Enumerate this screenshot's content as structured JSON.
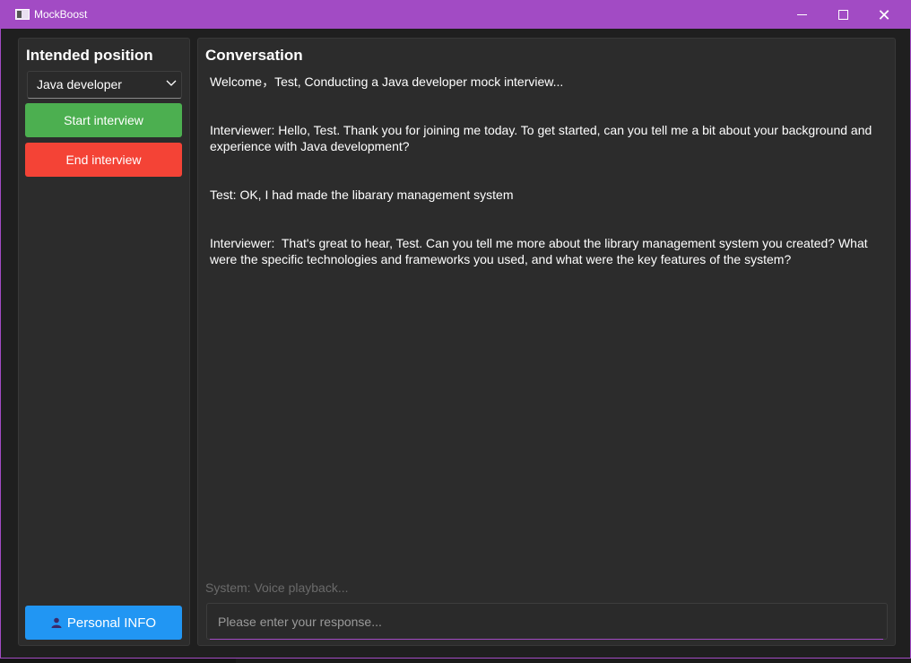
{
  "window": {
    "title": "MockBoost"
  },
  "left_panel": {
    "heading": "Intended position",
    "position_select": {
      "value": "Java developer"
    },
    "start_button": "Start interview",
    "end_button": "End interview",
    "info_button": "Personal INFO"
  },
  "right_panel": {
    "heading": "Conversation",
    "messages": [
      "Welcome，Test, Conducting a Java developer mock interview...",
      "Interviewer: Hello, Test. Thank you for joining me today. To get started, can you tell me a bit about your background and experience with Java development?",
      "Test: OK, I had made the libarary management system",
      "Interviewer:  That's great to hear, Test. Can you tell me more about the library management system you created? What were the specific technologies and frameworks you used, and what were the key features of the system?"
    ],
    "system_status": "System: Voice playback...",
    "input_placeholder": "Please enter your response..."
  },
  "colors": {
    "accent": "#a24bc4",
    "start": "#4caf50",
    "end": "#f44336",
    "info": "#2196f3"
  },
  "icons": {
    "app": "app-window-icon",
    "select": "chevron-down-icon",
    "info": "user-icon"
  }
}
